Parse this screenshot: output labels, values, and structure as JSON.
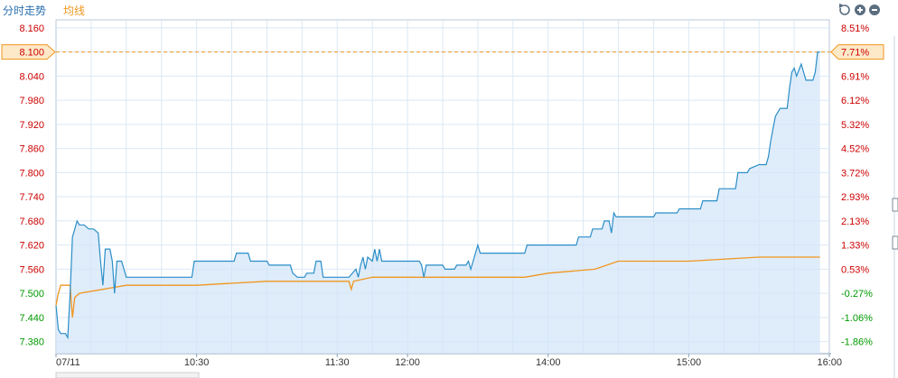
{
  "header": {
    "tab_intraday": "分时走势",
    "tab_avg": "均线"
  },
  "colors": {
    "price_line": "#2a8ec8",
    "avg_line": "#f0961e",
    "up": "#cc0000",
    "down": "#009900",
    "fill": "#d4e6f8",
    "grid": "#dbe8f4",
    "reference": "#f0961e"
  },
  "icons": {
    "undo": "undo-icon",
    "zoom_in": "zoom-in-icon",
    "zoom_out": "zoom-out-icon"
  },
  "chart_data": {
    "type": "line",
    "ylim": [
      7.35,
      8.18
    ],
    "reference_price": 7.52,
    "price_ticks": [
      "8.160",
      "8.100",
      "8.040",
      "7.980",
      "7.920",
      "7.860",
      "7.800",
      "7.740",
      "7.680",
      "7.620",
      "7.560",
      "7.500",
      "7.440",
      "7.380"
    ],
    "pct_ticks": [
      "8.51%",
      "7.71%",
      "6.91%",
      "6.12%",
      "5.32%",
      "4.52%",
      "3.72%",
      "2.93%",
      "2.13%",
      "1.33%",
      "0.53%",
      "-0.27%",
      "-1.06%",
      "-1.86%"
    ],
    "highlight": {
      "price": "8.100",
      "pct": "7.71%",
      "value": 8.1
    },
    "x_labels": [
      {
        "label": "07/11",
        "t": 0
      },
      {
        "label": "10:30",
        "t": 60
      },
      {
        "label": "11:30",
        "t": 120
      },
      {
        "label": "12:00",
        "t": 150
      },
      {
        "label": "14:00",
        "t": 210
      },
      {
        "label": "15:00",
        "t": 270
      },
      {
        "label": "16:00",
        "t": 330
      }
    ],
    "series": [
      {
        "key": "price",
        "points": [
          [
            0,
            7.47
          ],
          [
            1,
            7.41
          ],
          [
            2,
            7.4
          ],
          [
            4,
            7.4
          ],
          [
            5,
            7.39
          ],
          [
            6,
            7.5
          ],
          [
            7,
            7.64
          ],
          [
            8,
            7.66
          ],
          [
            9,
            7.68
          ],
          [
            10,
            7.67
          ],
          [
            12,
            7.67
          ],
          [
            14,
            7.66
          ],
          [
            16,
            7.66
          ],
          [
            18,
            7.65
          ],
          [
            19,
            7.58
          ],
          [
            20,
            7.52
          ],
          [
            21,
            7.61
          ],
          [
            23,
            7.61
          ],
          [
            24,
            7.58
          ],
          [
            25,
            7.5
          ],
          [
            26,
            7.58
          ],
          [
            28,
            7.58
          ],
          [
            30,
            7.54
          ],
          [
            40,
            7.54
          ],
          [
            50,
            7.54
          ],
          [
            58,
            7.54
          ],
          [
            59,
            7.58
          ],
          [
            70,
            7.58
          ],
          [
            76,
            7.58
          ],
          [
            77,
            7.6
          ],
          [
            82,
            7.6
          ],
          [
            83,
            7.58
          ],
          [
            90,
            7.58
          ],
          [
            91,
            7.57
          ],
          [
            100,
            7.57
          ],
          [
            101,
            7.55
          ],
          [
            103,
            7.54
          ],
          [
            106,
            7.54
          ],
          [
            107,
            7.55
          ],
          [
            110,
            7.55
          ],
          [
            111,
            7.58
          ],
          [
            113,
            7.58
          ],
          [
            114,
            7.54
          ],
          [
            125,
            7.54
          ],
          [
            128,
            7.56
          ],
          [
            129,
            7.54
          ],
          [
            130,
            7.57
          ],
          [
            131,
            7.59
          ],
          [
            132,
            7.56
          ],
          [
            133,
            7.59
          ],
          [
            135,
            7.58
          ],
          [
            136,
            7.61
          ],
          [
            137,
            7.58
          ],
          [
            138,
            7.61
          ],
          [
            139,
            7.58
          ],
          [
            145,
            7.58
          ],
          [
            150,
            7.58
          ],
          [
            155,
            7.58
          ],
          [
            156,
            7.57
          ],
          [
            157,
            7.54
          ],
          [
            158,
            7.57
          ],
          [
            165,
            7.57
          ],
          [
            166,
            7.56
          ],
          [
            170,
            7.56
          ],
          [
            171,
            7.57
          ],
          [
            175,
            7.57
          ],
          [
            176,
            7.58
          ],
          [
            177,
            7.56
          ],
          [
            178,
            7.58
          ],
          [
            179,
            7.6
          ],
          [
            180,
            7.62
          ],
          [
            181,
            7.6
          ],
          [
            190,
            7.6
          ],
          [
            200,
            7.6
          ],
          [
            201,
            7.62
          ],
          [
            222,
            7.62
          ],
          [
            223,
            7.64
          ],
          [
            228,
            7.64
          ],
          [
            229,
            7.66
          ],
          [
            233,
            7.66
          ],
          [
            234,
            7.68
          ],
          [
            236,
            7.68
          ],
          [
            237,
            7.65
          ],
          [
            238,
            7.7
          ],
          [
            239,
            7.69
          ],
          [
            250,
            7.69
          ],
          [
            255,
            7.69
          ],
          [
            256,
            7.7
          ],
          [
            265,
            7.7
          ],
          [
            266,
            7.71
          ],
          [
            275,
            7.71
          ],
          [
            276,
            7.73
          ],
          [
            282,
            7.73
          ],
          [
            283,
            7.76
          ],
          [
            290,
            7.76
          ],
          [
            291,
            7.8
          ],
          [
            295,
            7.8
          ],
          [
            296,
            7.81
          ],
          [
            300,
            7.82
          ],
          [
            303,
            7.82
          ],
          [
            304,
            7.84
          ],
          [
            305,
            7.88
          ],
          [
            306,
            7.91
          ],
          [
            307,
            7.94
          ],
          [
            309,
            7.96
          ],
          [
            312,
            7.96
          ],
          [
            313,
            8.01
          ],
          [
            314,
            8.05
          ],
          [
            315,
            8.06
          ],
          [
            316,
            8.04
          ],
          [
            318,
            8.07
          ],
          [
            319,
            8.05
          ],
          [
            320,
            8.03
          ],
          [
            323,
            8.03
          ],
          [
            324,
            8.05
          ],
          [
            325,
            8.1
          ],
          [
            326,
            8.1
          ]
        ]
      },
      {
        "key": "avg",
        "points": [
          [
            0,
            7.47
          ],
          [
            1,
            7.5
          ],
          [
            2,
            7.52
          ],
          [
            6,
            7.52
          ],
          [
            7,
            7.44
          ],
          [
            8,
            7.49
          ],
          [
            10,
            7.5
          ],
          [
            20,
            7.51
          ],
          [
            30,
            7.52
          ],
          [
            60,
            7.52
          ],
          [
            90,
            7.53
          ],
          [
            120,
            7.53
          ],
          [
            125,
            7.53
          ],
          [
            126,
            7.51
          ],
          [
            127,
            7.53
          ],
          [
            135,
            7.54
          ],
          [
            150,
            7.54
          ],
          [
            200,
            7.54
          ],
          [
            210,
            7.55
          ],
          [
            230,
            7.56
          ],
          [
            240,
            7.58
          ],
          [
            270,
            7.58
          ],
          [
            300,
            7.59
          ],
          [
            326,
            7.59
          ]
        ]
      }
    ],
    "grid": true,
    "legend": "top-left"
  }
}
